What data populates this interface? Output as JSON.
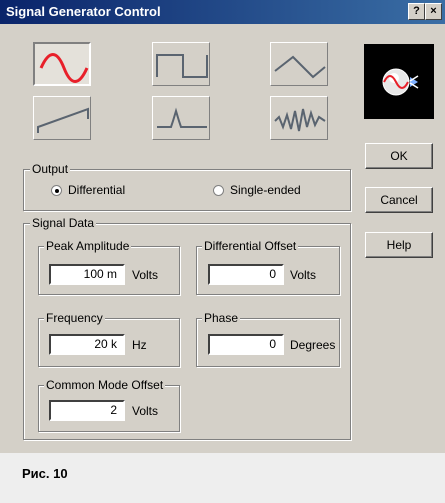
{
  "window": {
    "title": "Signal Generator Control",
    "help_button": "?",
    "close_button": "×"
  },
  "waveforms": [
    {
      "name": "sine",
      "selected": true
    },
    {
      "name": "square",
      "selected": false
    },
    {
      "name": "triangle",
      "selected": false
    },
    {
      "name": "sawtooth",
      "selected": false
    },
    {
      "name": "pulse",
      "selected": false
    },
    {
      "name": "noise",
      "selected": false
    }
  ],
  "output": {
    "group_label": "Output",
    "options": [
      "Differential",
      "Single-ended"
    ],
    "selected": "Differential"
  },
  "signal_data": {
    "group_label": "Signal Data",
    "peak_amplitude": {
      "label": "Peak Amplitude",
      "value": "100 m",
      "unit": "Volts"
    },
    "differential_offset": {
      "label": "Differential Offset",
      "value": "0",
      "unit": "Volts"
    },
    "frequency": {
      "label": "Frequency",
      "value": "20 k",
      "unit": "Hz"
    },
    "phase": {
      "label": "Phase",
      "value": "0",
      "unit": "Degrees"
    },
    "common_mode_offset": {
      "label": "Common Mode Offset",
      "value": "2",
      "unit": "Volts"
    }
  },
  "buttons": {
    "ok": "OK",
    "cancel": "Cancel",
    "help": "Help"
  },
  "caption": "Рис. 10",
  "colors": {
    "selected_wave": "#e8202a",
    "idle_wave": "#5a6470",
    "title_bar": "#0a246a"
  }
}
